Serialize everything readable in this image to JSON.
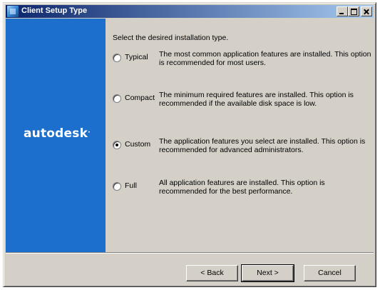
{
  "window": {
    "title": "Client Setup Type",
    "icons": {
      "app": "setup-app-icon",
      "minimize": "minimize-icon",
      "maximize": "maximize-icon",
      "close": "close-icon"
    }
  },
  "sidebar": {
    "brand": "autodesk",
    "brand_mark": "."
  },
  "main": {
    "instruction": "Select the desired installation type.",
    "selected": "Custom",
    "options": [
      {
        "label": "Typical",
        "description": "The most common application features are installed. This option is recommended for most users."
      },
      {
        "label": "Compact",
        "description": "The minimum required features are installed. This option is recommended if the available disk space is low."
      },
      {
        "label": "Custom",
        "description": "The application features you select are installed. This option is recommended for advanced administrators."
      },
      {
        "label": "Full",
        "description": "All application features are installed. This option is recommended for the best performance."
      }
    ]
  },
  "buttons": {
    "back": "< Back",
    "next": "Next >",
    "cancel": "Cancel"
  },
  "colors": {
    "sidebar": "#1d6fcd",
    "dialog": "#d4d0c8",
    "titlebar_start": "#0a246a",
    "titlebar_end": "#a6caf0"
  }
}
